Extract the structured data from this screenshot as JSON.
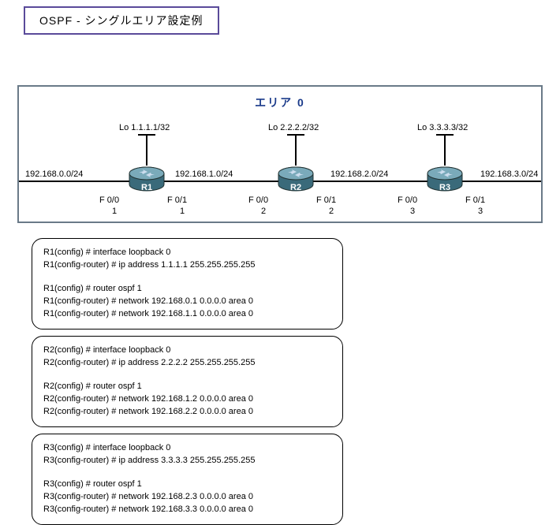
{
  "title": "OSPF - シングルエリア設定例",
  "area_title": "エリア  0",
  "loopbacks": {
    "r1": "Lo 1.1.1.1/32",
    "r2": "Lo 2.2.2.2/32",
    "r3": "Lo 3.3.3.3/32"
  },
  "nets": {
    "n0": "192.168.0.0/24",
    "n1": "192.168.1.0/24",
    "n2": "192.168.2.0/24",
    "n3": "192.168.3.0/24"
  },
  "iface": {
    "r1_left_if": "F 0/0",
    "r1_left_sub": "1",
    "r1_right_if": "F 0/1",
    "r1_right_sub": "1",
    "r2_left_if": "F 0/0",
    "r2_left_sub": "2",
    "r2_right_if": "F 0/1",
    "r2_right_sub": "2",
    "r3_left_if": "F 0/0",
    "r3_left_sub": "3",
    "r3_right_if": "F 0/1",
    "r3_right_sub": "3"
  },
  "router_names": {
    "r1": "R1",
    "r2": "R2",
    "r3": "R3"
  },
  "config": {
    "r1": {
      "l1": "R1(config) # interface loopback 0",
      "l2": "R1(config-router) # ip address 1.1.1.1 255.255.255.255",
      "l3": "R1(config) # router ospf 1",
      "l4": "R1(config-router) # network 192.168.0.1 0.0.0.0 area 0",
      "l5": "R1(config-router) # network 192.168.1.1 0.0.0.0 area 0"
    },
    "r2": {
      "l1": "R2(config) # interface loopback 0",
      "l2": "R2(config-router) # ip address 2.2.2.2 255.255.255.255",
      "l3": "R2(config) # router ospf 1",
      "l4": "R2(config-router) # network 192.168.1.2 0.0.0.0 area 0",
      "l5": "R2(config-router) # network 192.168.2.2 0.0.0.0 area 0"
    },
    "r3": {
      "l1": "R3(config) # interface loopback 0",
      "l2": "R3(config-router) # ip address 3.3.3.3 255.255.255.255",
      "l3": "R3(config) # router ospf 1",
      "l4": "R3(config-router) # network 192.168.2.3 0.0.0.0 area 0",
      "l5": "R3(config-router) # network 192.168.3.3 0.0.0.0 area 0"
    }
  }
}
